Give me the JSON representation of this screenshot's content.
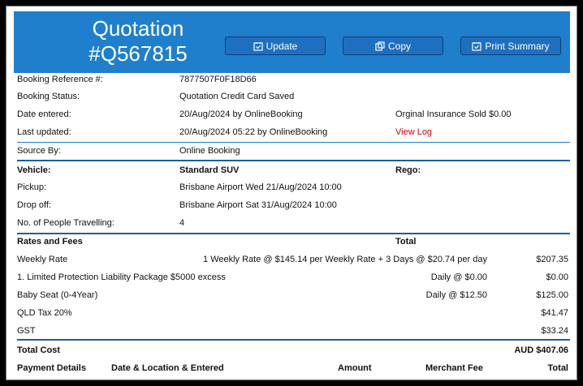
{
  "header": {
    "title_line1": "Quotation",
    "title_line2": "#Q567815",
    "buttons": {
      "update": "Update",
      "copy": "Copy",
      "print": "Print Summary"
    },
    "color": "#1f7fcd"
  },
  "booking": {
    "ref_label": "Booking Reference #:",
    "ref_value": "7877507F0F18D66",
    "status_label": "Booking Status:",
    "status_value": "Quotation Credit Card Saved",
    "entered_label": "Date entered:",
    "entered_value": "20/Aug/2024 by OnlineBooking",
    "insurance_text": "Orginal Insurance Sold $0.00",
    "updated_label": "Last updated:",
    "updated_value": "20/Aug/2024 05:22 by OnlineBooking",
    "view_log": "View Log",
    "source_label": "Source By:",
    "source_value": "Online Booking"
  },
  "vehicle": {
    "label": "Vehicle:",
    "value": "Standard SUV",
    "rego_label": "Rego:",
    "pickup_label": "Pickup:",
    "pickup_value": "Brisbane Airport Wed 21/Aug/2024 10:00",
    "dropoff_label": "Drop off:",
    "dropoff_value": "Brisbane Airport Sat 31/Aug/2024 10:00",
    "people_label": "No. of People Travelling:",
    "people_value": "4"
  },
  "rates": {
    "heading": "Rates and Fees",
    "total_heading": "Total",
    "items": [
      {
        "name": "Weekly Rate",
        "detail": "1 Weekly Rate @ $145.14 per Weekly Rate + 3 Days @ $20.74 per day",
        "total": "$207.35"
      },
      {
        "name": "1. Limited Protection Liability Package $5000 excess",
        "detail": "Daily @ $0.00",
        "total": "$0.00"
      },
      {
        "name": "Baby Seat (0-4Year)",
        "detail": "Daily @ $12.50",
        "total": "$125.00"
      },
      {
        "name": "QLD Tax 20%",
        "detail": "",
        "total": "$41.47"
      },
      {
        "name": "GST",
        "detail": "",
        "total": "$33.24"
      }
    ],
    "total_cost_label": "Total Cost",
    "total_cost_value": "AUD $407.06"
  },
  "payment": {
    "headers": [
      "Payment Details",
      "Date & Location & Entered",
      "Amount",
      "Merchant Fee",
      "Total"
    ]
  }
}
